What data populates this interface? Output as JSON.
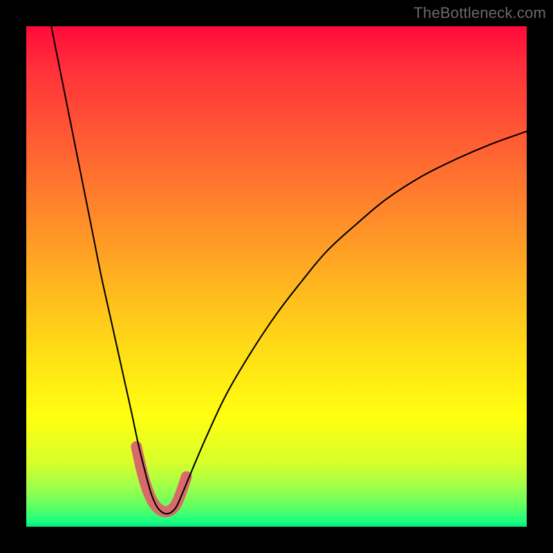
{
  "watermark": "TheBottleneck.com",
  "chart_data": {
    "type": "line",
    "title": "",
    "xlabel": "",
    "ylabel": "",
    "xlim": [
      0,
      100
    ],
    "ylim": [
      0,
      100
    ],
    "grid": false,
    "legend": false,
    "gradient_colors": {
      "top": "#ff0a3a",
      "mid": "#ffff10",
      "bottom": "#00e87a"
    },
    "series": [
      {
        "name": "bottleneck-curve",
        "color": "#000000",
        "stroke_width": 2.1,
        "x": [
          5.0,
          7.0,
          9.0,
          11.0,
          13.0,
          15.0,
          17.0,
          19.0,
          21.0,
          22.5,
          24.0,
          25.0,
          26.0,
          27.0,
          28.0,
          29.0,
          30.0,
          31.0,
          33.0,
          36.0,
          40.0,
          45.0,
          50.0,
          55.0,
          60.0,
          66.0,
          72.0,
          79.0,
          86.0,
          93.0,
          100.0
        ],
        "values": [
          100.0,
          90.0,
          80.0,
          70.0,
          60.0,
          50.0,
          41.0,
          32.0,
          23.0,
          16.0,
          10.0,
          6.5,
          4.2,
          3.0,
          2.6,
          2.9,
          4.0,
          6.2,
          11.0,
          18.0,
          26.5,
          35.0,
          42.5,
          49.0,
          55.0,
          60.5,
          65.5,
          70.0,
          73.5,
          76.5,
          79.0
        ]
      },
      {
        "name": "min-highlight",
        "color": "#d86a6a",
        "stroke_width": 16,
        "linecap": "round",
        "x": [
          22.0,
          23.0,
          24.0,
          25.0,
          26.0,
          27.0,
          28.0,
          29.0,
          30.0,
          31.0,
          32.0
        ],
        "values": [
          16.0,
          11.5,
          8.0,
          5.5,
          4.0,
          3.2,
          3.0,
          3.4,
          4.6,
          7.0,
          10.0
        ]
      }
    ],
    "annotations": []
  }
}
